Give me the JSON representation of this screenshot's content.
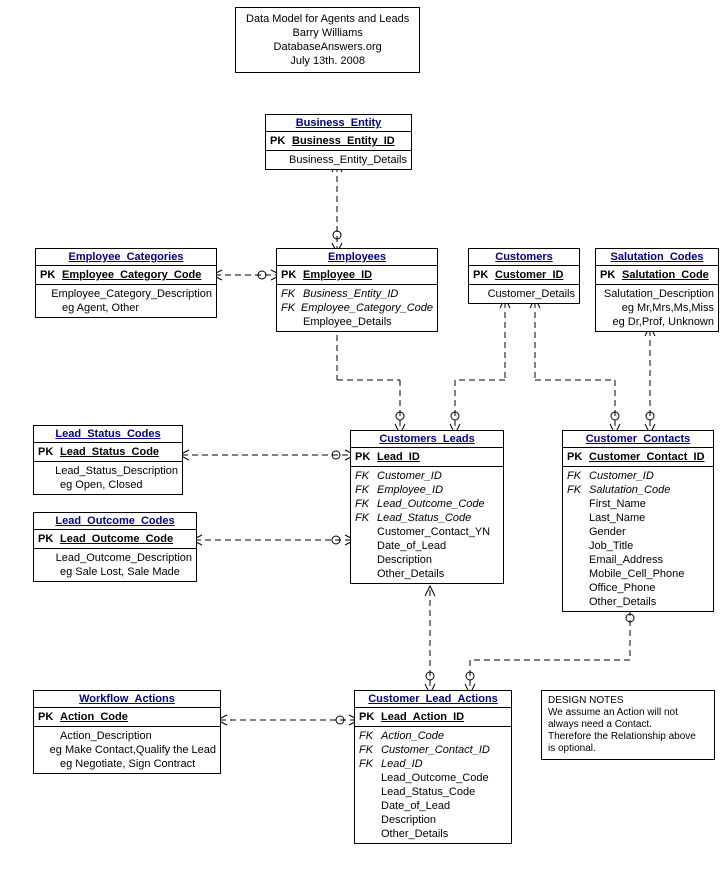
{
  "header": {
    "line1": "Data Model for Agents and Leads",
    "line2": "Barry Williams",
    "line3": "DatabaseAnswers.org",
    "line4": "July 13th. 2008"
  },
  "design_note": {
    "l1": "DESIGN NOTES",
    "l2": "We assume an Action will not",
    "l3": "always need a Contact.",
    "l4": "Therefore the Relationship above",
    "l5": "is optional."
  },
  "entities": {
    "business_entity": {
      "title": "Business_Entity",
      "pk": "Business_Entity_ID",
      "a1": "Business_Entity_Details"
    },
    "employee_categories": {
      "title": "Employee_Categories",
      "pk": "Employee_Category_Code",
      "a1": "Employee_Category_Description",
      "a2": "eg Agent, Other"
    },
    "employees": {
      "title": "Employees",
      "pk": "Employee_ID",
      "f1": "Business_Entity_ID",
      "f2": "Employee_Category_Code",
      "a1": "Employee_Details"
    },
    "customers": {
      "title": "Customers",
      "pk": "Customer_ID",
      "a1": "Customer_Details"
    },
    "salutation_codes": {
      "title": "Salutation_Codes",
      "pk": "Salutation_Code",
      "a1": "Salutation_Description",
      "a2": "eg Mr,Mrs,Ms,Miss",
      "a3": "eg Dr,Prof, Unknown"
    },
    "lead_status_codes": {
      "title": "Lead_Status_Codes",
      "pk": "Lead_Status_Code",
      "a1": "Lead_Status_Description",
      "a2": "eg Open, Closed"
    },
    "lead_outcome_codes": {
      "title": "Lead_Outcome_Codes",
      "pk": "Lead_Outcome_Code",
      "a1": "Lead_Outcome_Description",
      "a2": "eg Sale Lost, Sale Made"
    },
    "customers_leads": {
      "title": "Customers_Leads",
      "pk": "Lead_ID",
      "f1": "Customer_ID",
      "f2": "Employee_ID",
      "f3": "Lead_Outcome_Code",
      "f4": "Lead_Status_Code",
      "a1": "Customer_Contact_YN",
      "a2": "Date_of_Lead",
      "a3": "Description",
      "a4": "Other_Details"
    },
    "customer_contacts": {
      "title": "Customer_Contacts",
      "pk": "Customer_Contact_ID",
      "f1": "Customer_ID",
      "f2": "Salutation_Code",
      "a1": "First_Name",
      "a2": "Last_Name",
      "a3": "Gender",
      "a4": "Job_Title",
      "a5": "Email_Address",
      "a6": "Mobile_Cell_Phone",
      "a7": "Office_Phone",
      "a8": "Other_Details"
    },
    "workflow_actions": {
      "title": "Workflow_Actions",
      "pk": "Action_Code",
      "a1": "Action_Description",
      "a2": "eg Make Contact,Qualify the Lead",
      "a3": "eg Negotiate, Sign Contract"
    },
    "customer_lead_actions": {
      "title": "Customer_Lead_Actions",
      "pk": "Lead_Action_ID",
      "f1": "Action_Code",
      "f2": "Customer_Contact_ID",
      "f3": "Lead_ID",
      "a1": "Lead_Outcome_Code",
      "a2": "Lead_Status_Code",
      "a3": "Date_of_Lead",
      "a4": "Description",
      "a5": "Other_Details"
    }
  },
  "relationships": [
    {
      "from": "Business_Entity",
      "to": "Employees",
      "type": "one-to-many",
      "via": "Business_Entity_ID"
    },
    {
      "from": "Employee_Categories",
      "to": "Employees",
      "type": "one-to-many",
      "via": "Employee_Category_Code"
    },
    {
      "from": "Employees",
      "to": "Customers_Leads",
      "type": "one-to-many",
      "via": "Employee_ID"
    },
    {
      "from": "Customers",
      "to": "Customers_Leads",
      "type": "one-to-many",
      "via": "Customer_ID"
    },
    {
      "from": "Customers",
      "to": "Customer_Contacts",
      "type": "one-to-many",
      "via": "Customer_ID"
    },
    {
      "from": "Salutation_Codes",
      "to": "Customer_Contacts",
      "type": "one-to-many",
      "via": "Salutation_Code"
    },
    {
      "from": "Lead_Status_Codes",
      "to": "Customers_Leads",
      "type": "one-to-many",
      "via": "Lead_Status_Code"
    },
    {
      "from": "Lead_Outcome_Codes",
      "to": "Customers_Leads",
      "type": "one-to-many",
      "via": "Lead_Outcome_Code"
    },
    {
      "from": "Customers_Leads",
      "to": "Customer_Lead_Actions",
      "type": "one-to-many",
      "via": "Lead_ID"
    },
    {
      "from": "Workflow_Actions",
      "to": "Customer_Lead_Actions",
      "type": "one-to-many",
      "via": "Action_Code"
    },
    {
      "from": "Customer_Contacts",
      "to": "Customer_Lead_Actions",
      "type": "one-to-many-optional",
      "via": "Customer_Contact_ID"
    }
  ]
}
